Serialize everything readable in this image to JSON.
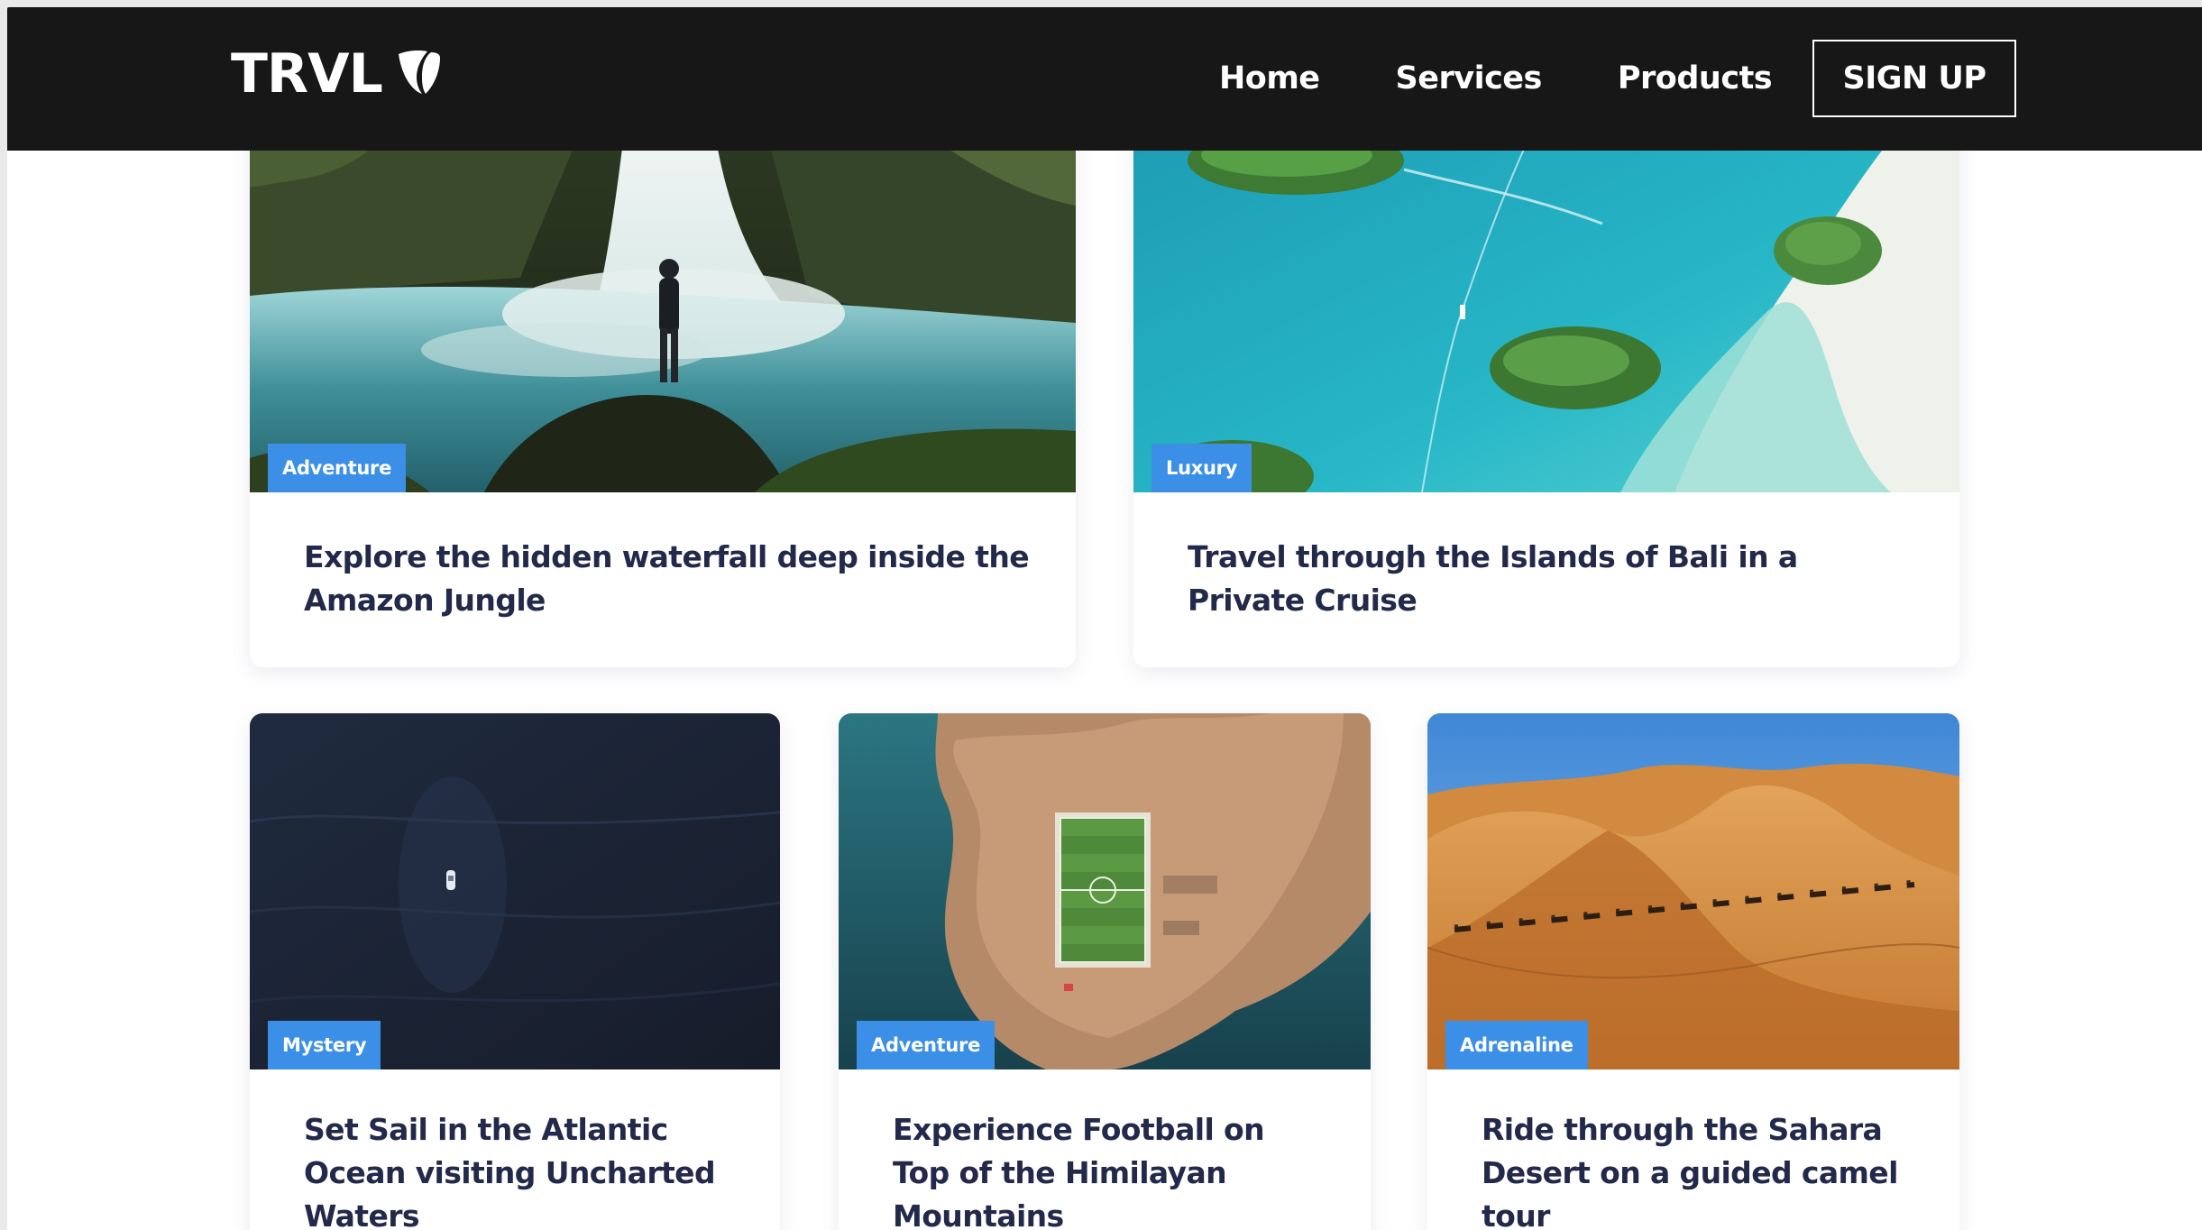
{
  "navbar": {
    "logo_text": "TRVL",
    "links": [
      "Home",
      "Services",
      "Products"
    ],
    "signup_label": "SIGN UP",
    "logo_icon": "typo3-shield-icon"
  },
  "colors": {
    "navbar_bg": "#171717",
    "badge_bg": "#3b8fe6",
    "title_text": "#22294a",
    "page_bg": "#ffffff"
  },
  "cards": [
    {
      "category": "Adventure",
      "title": "Explore the hidden waterfall deep inside the Amazon Jungle",
      "image": "waterfall-photo"
    },
    {
      "category": "Luxury",
      "title": "Travel through the Islands of Bali in a Private Cruise",
      "image": "aerial-islands-photo"
    },
    {
      "category": "Mystery",
      "title": "Set Sail in the Atlantic Ocean visiting Uncharted Waters",
      "image": "ocean-boat-photo"
    },
    {
      "category": "Adventure",
      "title": "Experience Football on Top of the Himilayan Mountains",
      "image": "island-football-field-photo"
    },
    {
      "category": "Adrenaline",
      "title": "Ride through the Sahara Desert on a guided camel tour",
      "image": "desert-camels-photo"
    }
  ]
}
